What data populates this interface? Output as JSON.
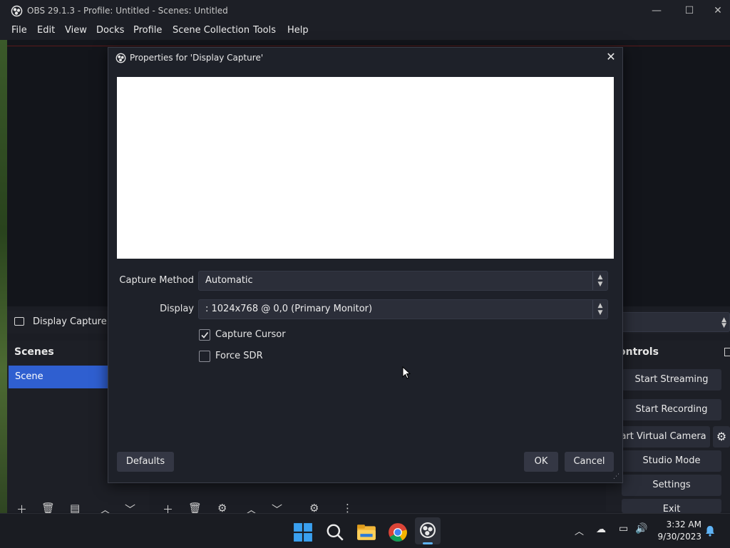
{
  "window": {
    "title": "OBS 29.1.3 - Profile: Untitled - Scenes: Untitled"
  },
  "menu": [
    "File",
    "Edit",
    "View",
    "Docks",
    "Profile",
    "Scene Collection",
    "Tools",
    "Help"
  ],
  "source_bar": {
    "source_name": "Display Capture"
  },
  "scenes_dock": {
    "title": "Scenes",
    "items": [
      "Scene"
    ]
  },
  "controls_dock": {
    "title": "ontrols",
    "buttons": [
      "Start Streaming",
      "Start Recording",
      "tart Virtual Camera",
      "Studio Mode",
      "Settings",
      "Exit"
    ]
  },
  "dialog": {
    "title": "Properties for 'Display Capture'",
    "capture_method_label": "Capture Method",
    "capture_method_value": "Automatic",
    "display_label": "Display",
    "display_value": ": 1024x768 @ 0,0 (Primary Monitor)",
    "capture_cursor_label": "Capture Cursor",
    "capture_cursor_checked": true,
    "force_sdr_label": "Force SDR",
    "force_sdr_checked": false,
    "defaults_label": "Defaults",
    "ok_label": "OK",
    "cancel_label": "Cancel"
  },
  "taskbar": {
    "time": "3:32 AM",
    "date": "9/30/2023"
  },
  "colors": {
    "accent": "#2f5fd0",
    "dialog_bg": "#1e2129",
    "preview_bg": "#ffffff"
  }
}
